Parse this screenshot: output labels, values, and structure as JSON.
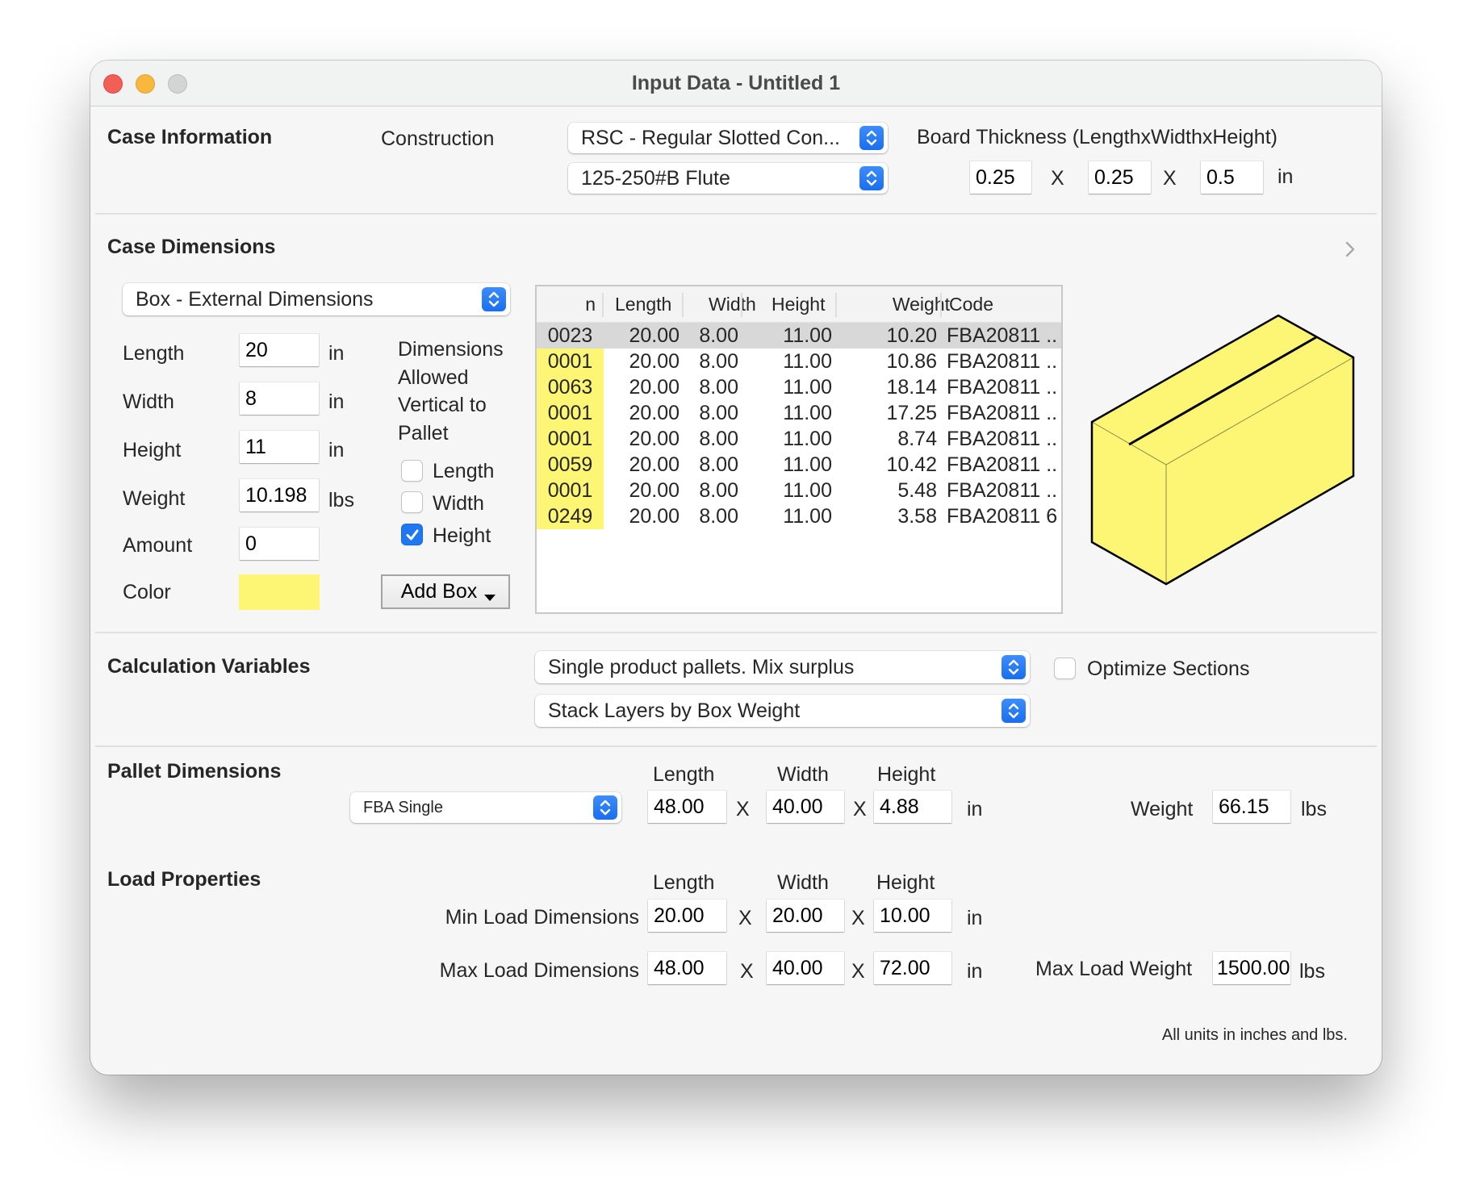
{
  "window": {
    "title": "Input Data - Untitled 1",
    "controls": [
      "close",
      "minimize",
      "zoom"
    ]
  },
  "case_information": {
    "heading": "Case Information",
    "construction_label": "Construction",
    "construction_value": "RSC - Regular Slotted Con...",
    "flute_value": "125-250#B Flute",
    "board_thickness_label": "Board Thickness (LengthxWidthxHeight)",
    "board_thickness": {
      "length": "0.25",
      "width": "0.25",
      "height": "0.5",
      "separator": "X",
      "unit": "in"
    }
  },
  "case_dimensions": {
    "heading": "Case Dimensions",
    "expand_icon": "chevron-right-icon",
    "mode_value": "Box - External Dimensions",
    "fields": [
      {
        "label": "Length",
        "value": "20",
        "unit": "in"
      },
      {
        "label": "Width",
        "value": "8",
        "unit": "in"
      },
      {
        "label": "Height",
        "value": "11",
        "unit": "in"
      },
      {
        "label": "Weight",
        "value": "10.198",
        "unit": "lbs"
      },
      {
        "label": "Amount",
        "value": "0",
        "unit": ""
      }
    ],
    "color_label": "Color",
    "color_value": "#fdf674",
    "vertical_label_lines": [
      "Dimensions",
      "Allowed",
      "Vertical to",
      "Pallet"
    ],
    "vertical_options": [
      {
        "label": "Length",
        "checked": false
      },
      {
        "label": "Width",
        "checked": false
      },
      {
        "label": "Height",
        "checked": true
      }
    ],
    "add_box_label": "Add Box",
    "table": {
      "columns": [
        "n",
        "Length",
        "Width",
        "Height",
        "Weight",
        "Code"
      ],
      "rows": [
        {
          "n": "0023",
          "length": "20.00",
          "width": "8.00",
          "height": "11.00",
          "weight": "10.20",
          "code": "FBA20811 ..",
          "selected": true,
          "highlight": false
        },
        {
          "n": "0001",
          "length": "20.00",
          "width": "8.00",
          "height": "11.00",
          "weight": "10.86",
          "code": "FBA20811 ..",
          "selected": false,
          "highlight": true
        },
        {
          "n": "0063",
          "length": "20.00",
          "width": "8.00",
          "height": "11.00",
          "weight": "18.14",
          "code": "FBA20811 ..",
          "selected": false,
          "highlight": true
        },
        {
          "n": "0001",
          "length": "20.00",
          "width": "8.00",
          "height": "11.00",
          "weight": "17.25",
          "code": "FBA20811 ..",
          "selected": false,
          "highlight": true
        },
        {
          "n": "0001",
          "length": "20.00",
          "width": "8.00",
          "height": "11.00",
          "weight": "8.74",
          "code": "FBA20811 ..",
          "selected": false,
          "highlight": true
        },
        {
          "n": "0059",
          "length": "20.00",
          "width": "8.00",
          "height": "11.00",
          "weight": "10.42",
          "code": "FBA20811 ..",
          "selected": false,
          "highlight": true
        },
        {
          "n": "0001",
          "length": "20.00",
          "width": "8.00",
          "height": "11.00",
          "weight": "5.48",
          "code": "FBA20811 ..",
          "selected": false,
          "highlight": true
        },
        {
          "n": "0249",
          "length": "20.00",
          "width": "8.00",
          "height": "11.00",
          "weight": "3.58",
          "code": "FBA20811 6",
          "selected": false,
          "highlight": true
        }
      ]
    },
    "preview": {
      "icon": "box-3d-icon",
      "fill": "#fdf674",
      "stroke": "#000000"
    }
  },
  "calculation_variables": {
    "heading": "Calculation Variables",
    "pallet_mode_value": "Single product pallets. Mix surplus",
    "stacking_value": "Stack Layers by Box Weight",
    "optimize_sections_label": "Optimize Sections",
    "optimize_sections_checked": false
  },
  "pallet_dimensions": {
    "heading": "Pallet Dimensions",
    "pallet_type_value": "FBA Single",
    "col_length": "Length",
    "col_width": "Width",
    "col_height": "Height",
    "length": "48.00",
    "width": "40.00",
    "height": "4.88",
    "separator": "X",
    "unit": "in",
    "weight_label": "Weight",
    "weight": "66.15",
    "weight_unit": "lbs"
  },
  "load_properties": {
    "heading": "Load Properties",
    "col_length": "Length",
    "col_width": "Width",
    "col_height": "Height",
    "separator": "X",
    "unit": "in",
    "min_label": "Min Load Dimensions",
    "min": {
      "length": "20.00",
      "width": "20.00",
      "height": "10.00"
    },
    "max_label": "Max Load Dimensions",
    "max": {
      "length": "48.00",
      "width": "40.00",
      "height": "72.00"
    },
    "max_weight_label": "Max Load Weight",
    "max_weight": "1500.00",
    "max_weight_unit": "lbs"
  },
  "footnote": "All units in inches and lbs."
}
